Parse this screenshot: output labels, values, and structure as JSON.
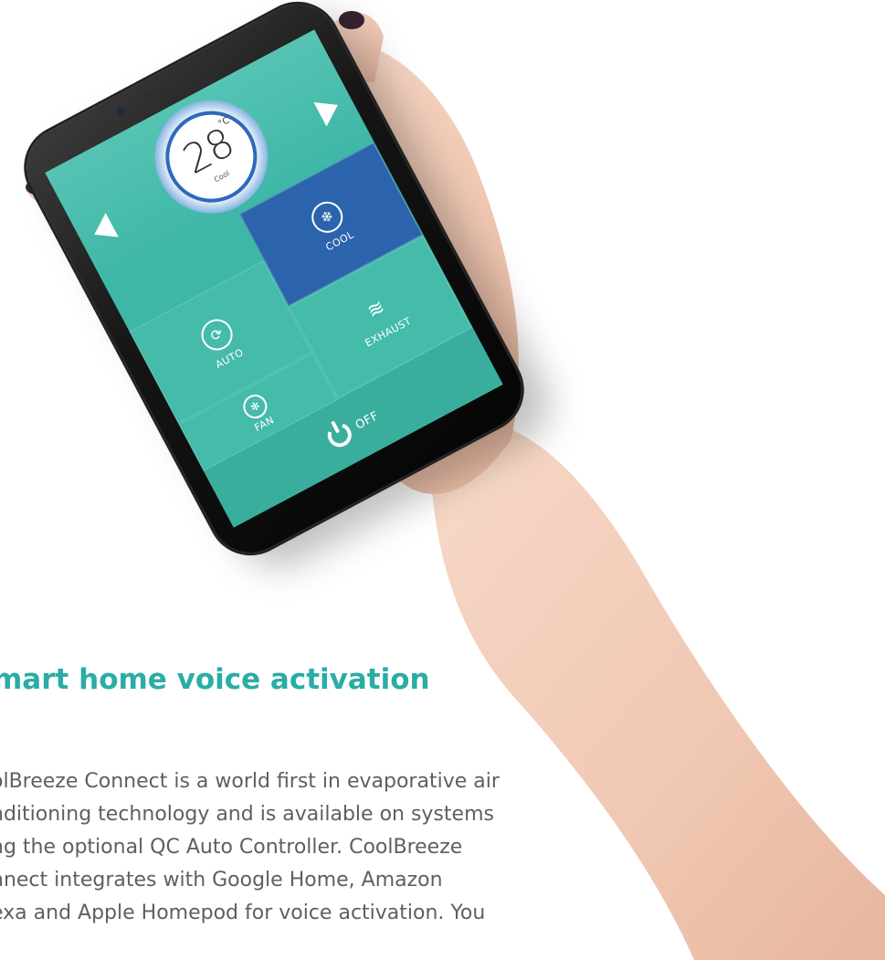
{
  "app": {
    "temperature": "28",
    "unit": "°C",
    "current_mode": "Cool",
    "modes": [
      {
        "key": "cool",
        "label": "COOL",
        "icon": "snowflake-icon",
        "active": true
      },
      {
        "key": "auto",
        "label": "AUTO",
        "icon": "cycle-icon",
        "active": false
      },
      {
        "key": "exhaust",
        "label": "EXHAUST",
        "icon": "exhaust-icon",
        "active": false
      },
      {
        "key": "fan",
        "label": "FAN",
        "icon": "fan-icon",
        "active": false
      }
    ],
    "power_label": "OFF",
    "colors": {
      "screen": "#3fb7a6",
      "active_tile": "#2c63ad",
      "accent": "#2aada5"
    }
  },
  "article": {
    "heading": "mart home voice activation",
    "lines": [
      "olBreeze Connect is a world first in evaporative air",
      "nditioning technology and is available on systems",
      "ng the optional QC Auto Controller. CoolBreeze",
      "nnect integrates with Google Home, Amazon",
      "exa and Apple Homepod for voice activation. You"
    ]
  }
}
